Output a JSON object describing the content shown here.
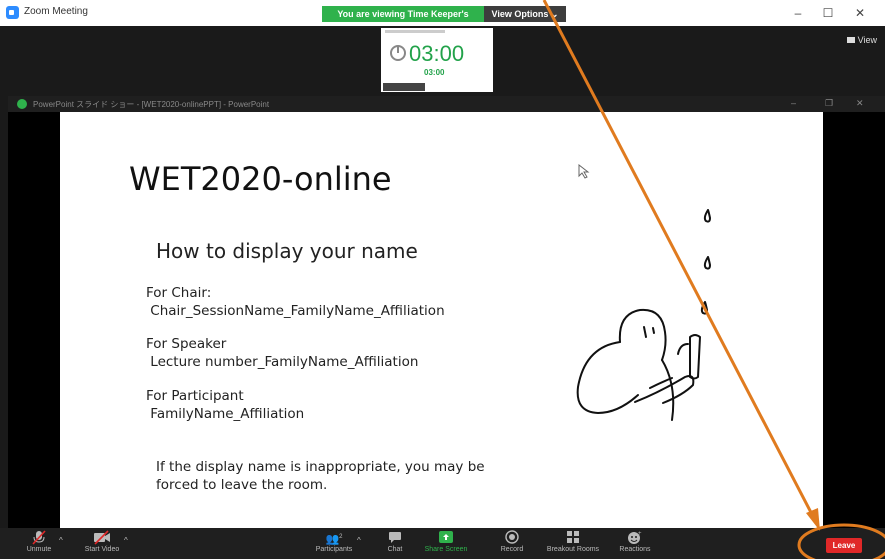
{
  "window": {
    "title": "Zoom Meeting"
  },
  "banner": {
    "viewing": "You are viewing Time Keeper's screen",
    "view_options": "View Options ⌄"
  },
  "view_button": {
    "label": "View"
  },
  "thumbnail": {
    "timer_big": "03:00",
    "timer_small": "03:00"
  },
  "ppt_window": {
    "title": "PowerPoint スライド ショー - [WET2020-onlinePPT] - PowerPoint"
  },
  "slide": {
    "title": "WET2020-online",
    "heading": "How to display your name",
    "chair_label": "For Chair:",
    "chair_format": " Chair_SessionName_FamilyName_Affiliation",
    "speaker_label": "For Speaker",
    "speaker_format": " Lecture number_FamilyName_Affiliation",
    "participant_label": "For Participant",
    "participant_format": " FamilyName_Affiliation",
    "notice_line1": "If the display name is inappropriate, you may be",
    "notice_line2": "forced to leave the room."
  },
  "toolbar": {
    "unmute": "Unmute",
    "start_video": "Start Video",
    "participants": "Participants",
    "participants_count": "2",
    "chat": "Chat",
    "share_screen": "Share Screen",
    "record": "Record",
    "breakout_rooms": "Breakout Rooms",
    "reactions": "Reactions",
    "leave": "Leave"
  },
  "colors": {
    "accent_green": "#2fb24c",
    "leave_red": "#e02828",
    "annotation_orange": "#e07b1f",
    "zoom_blue": "#2d8cff"
  },
  "icons": [
    "zoom-app-icon",
    "minimize-icon",
    "maximize-icon",
    "close-icon",
    "grid-view-icon",
    "timer-icon",
    "muted-microphone-icon",
    "video-off-icon",
    "participants-icon",
    "chat-icon",
    "share-screen-icon",
    "record-icon",
    "breakout-rooms-icon",
    "reactions-icon",
    "caret-up-icon",
    "mouse-pointer-icon"
  ]
}
